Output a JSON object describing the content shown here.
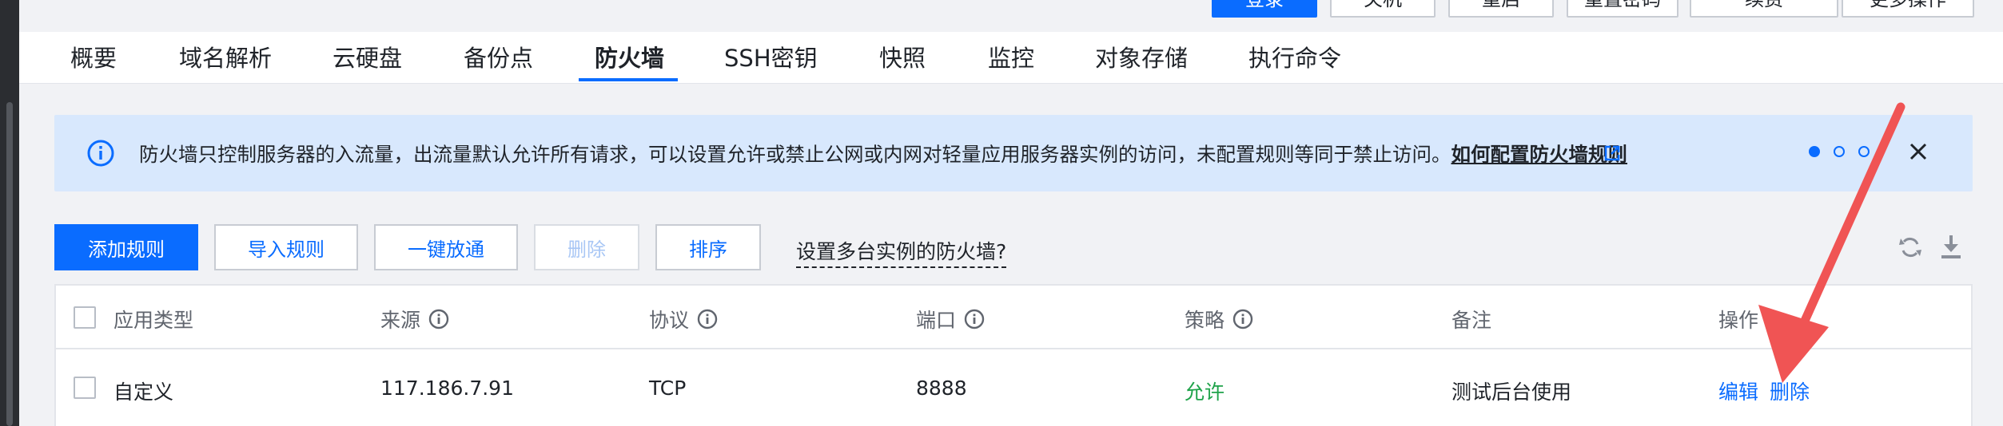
{
  "top_actions": {
    "login": "登录",
    "shutdown": "关机",
    "restart": "重启",
    "reset_password": "重置密码",
    "renew": "续费",
    "more_actions": "更多操作"
  },
  "tabs": [
    {
      "label": "概要"
    },
    {
      "label": "域名解析"
    },
    {
      "label": "云硬盘"
    },
    {
      "label": "备份点"
    },
    {
      "label": "防火墙",
      "active": true
    },
    {
      "label": "SSH密钥"
    },
    {
      "label": "快照"
    },
    {
      "label": "监控"
    },
    {
      "label": "对象存储"
    },
    {
      "label": "执行命令"
    }
  ],
  "notice": {
    "text": "防火墙只控制服务器的入流量，出流量默认允许所有请求，可以设置允许或禁止公网或内网对轻量应用服务器实例的访问，未配置规则等同于禁止访问。",
    "link": "如何配置防火墙规则",
    "pages_total": 3,
    "page_current": 1,
    "icon": "info-icon"
  },
  "toolbar": {
    "add_rule": "添加规则",
    "import_rules": "导入规则",
    "one_click_open": "一键放通",
    "delete": "删除",
    "sort": "排序",
    "multi_instance_help": "设置多台实例的防火墙?"
  },
  "table": {
    "headers": [
      "应用类型",
      "来源",
      "协议",
      "端口",
      "策略",
      "备注",
      "操作"
    ],
    "rows": [
      {
        "app_type": "自定义",
        "source": "117.186.7.91",
        "protocol": "TCP",
        "port": "8888",
        "policy": "允许",
        "remark": "测试后台使用",
        "actions": {
          "edit": "编辑",
          "delete": "删除"
        }
      }
    ]
  },
  "colors": {
    "primary": "#0a6cff",
    "policy_allow": "#1fa34a",
    "notice_bg": "#d8e8fd",
    "annotation_arrow": "#f05454"
  }
}
